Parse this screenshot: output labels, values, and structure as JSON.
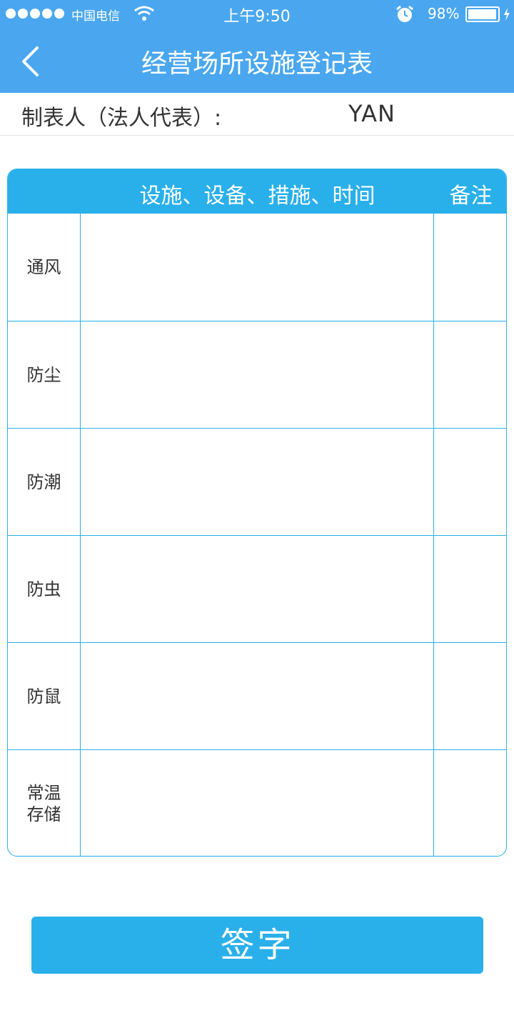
{
  "status_bar": {
    "carrier": "中国电信",
    "time": "上午9:50",
    "battery": "98%",
    "battery_level": 0.98,
    "icons": [
      "signal-dots-icon",
      "wifi-icon",
      "alarm-icon",
      "battery-icon",
      "charging-bolt-icon"
    ]
  },
  "nav": {
    "title": "经营场所设施登记表",
    "back_icon": "chevron-left-icon"
  },
  "form": {
    "maker_label": "制表人（法人代表）:",
    "maker_value": "YAN"
  },
  "table": {
    "header_main": "设施、设备、措施、时间",
    "header_note": "备注",
    "rows": [
      {
        "label": "通风",
        "content": "",
        "note": ""
      },
      {
        "label": "防尘",
        "content": "",
        "note": ""
      },
      {
        "label": "防潮",
        "content": "",
        "note": ""
      },
      {
        "label": "防虫",
        "content": "",
        "note": ""
      },
      {
        "label": "防鼠",
        "content": "",
        "note": ""
      },
      {
        "label": "常温存储",
        "content": "",
        "note": ""
      }
    ]
  },
  "actions": {
    "sign_label": "签字"
  },
  "colors": {
    "nav_bg": "#4aa7ef",
    "accent": "#29b0ea"
  }
}
